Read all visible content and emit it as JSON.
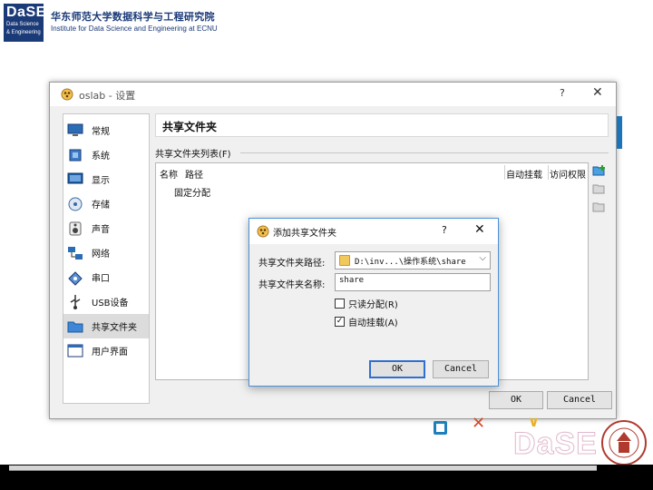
{
  "slide": {
    "logo_title": "DaSE",
    "logo_sub_1": "Data Science",
    "logo_sub_2": "& Engineering",
    "institute_cn": "华东师范大学数据科学与工程研究院",
    "institute_en": "Institute for Data Science and Engineering at ECNU",
    "footer_logo": "DaSE"
  },
  "settings_window": {
    "title": "oslab - 设置",
    "help_label": "?",
    "close_label": "✕",
    "sidebar": [
      {
        "label": "常规",
        "icon": "monitor-icon"
      },
      {
        "label": "系统",
        "icon": "chip-icon"
      },
      {
        "label": "显示",
        "icon": "display-icon"
      },
      {
        "label": "存储",
        "icon": "disk-icon"
      },
      {
        "label": "声音",
        "icon": "speaker-icon"
      },
      {
        "label": "网络",
        "icon": "network-icon"
      },
      {
        "label": "串口",
        "icon": "serial-port-icon"
      },
      {
        "label": "USB设备",
        "icon": "usb-icon"
      },
      {
        "label": "共享文件夹",
        "icon": "folder-icon",
        "selected": true
      },
      {
        "label": "用户界面",
        "icon": "window-icon"
      }
    ],
    "section_title": "共享文件夹",
    "group_label": "共享文件夹列表(F)",
    "table": {
      "columns": [
        "名称",
        "路径",
        "自动挂载",
        "访问权限"
      ],
      "rows": [
        "固定分配"
      ]
    },
    "ok_label": "OK",
    "cancel_label": "Cancel"
  },
  "dialog": {
    "title": "添加共享文件夹",
    "help_label": "?",
    "close_label": "✕",
    "path_label": "共享文件夹路径:",
    "path_value": "D:\\inv...\\操作系统\\share",
    "name_label": "共享文件夹名称:",
    "name_value": "share",
    "readonly_label": "只读分配(R)",
    "readonly_checked": false,
    "automount_label": "自动挂载(A)",
    "automount_checked": true,
    "ok_label": "OK",
    "cancel_label": "Cancel",
    "check_mark": "✓"
  },
  "colors": {
    "brand_blue": "#1b3a78",
    "dialog_border": "#4a90d9",
    "default_button_border": "#2f6fd1"
  }
}
